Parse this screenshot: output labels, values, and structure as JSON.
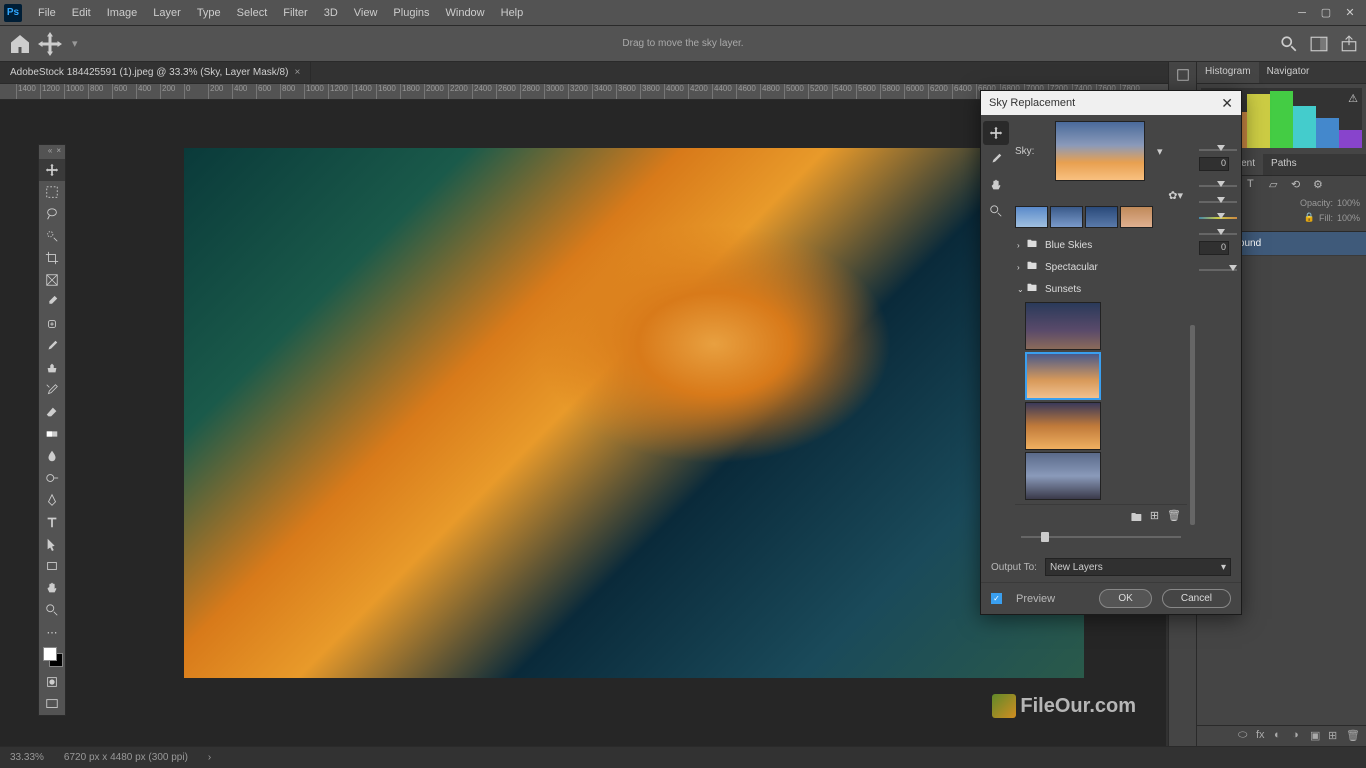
{
  "app": {
    "logo": "Ps"
  },
  "menubar": [
    "File",
    "Edit",
    "Image",
    "Layer",
    "Type",
    "Select",
    "Filter",
    "3D",
    "View",
    "Plugins",
    "Window",
    "Help"
  ],
  "optionsbar": {
    "hint": "Drag to move the sky layer."
  },
  "doctab": {
    "title": "AdobeStock 184425591 (1).jpeg @ 33.3% (Sky, Layer Mask/8)",
    "close": "×"
  },
  "ruler_marks": [
    "1400",
    "1200",
    "1000",
    "800",
    "600",
    "400",
    "200",
    "0",
    "200",
    "400",
    "600",
    "800",
    "1000",
    "1200",
    "1400",
    "1600",
    "1800",
    "2000",
    "2200",
    "2400",
    "2600",
    "2800",
    "3000",
    "3200",
    "3400",
    "3600",
    "3800",
    "4000",
    "4200",
    "4400",
    "4600",
    "4800",
    "5000",
    "5200",
    "5400",
    "5600",
    "5800",
    "6000",
    "6200",
    "6400",
    "6600",
    "6800",
    "7000",
    "7200",
    "7400",
    "7600",
    "7800"
  ],
  "dialog": {
    "title": "Sky Replacement",
    "sky_label": "Sky:",
    "categories": [
      {
        "name": "Blue Skies",
        "open": false
      },
      {
        "name": "Spectacular",
        "open": false
      },
      {
        "name": "Sunsets",
        "open": true
      }
    ],
    "output_label": "Output To:",
    "output_value": "New Layers",
    "preview_label": "Preview",
    "ok": "OK",
    "cancel": "Cancel",
    "slider_vals": [
      "0",
      "0"
    ]
  },
  "right_panel": {
    "tabs1": [
      "Histogram",
      "Navigator"
    ],
    "tabs2": [
      "Adjustment",
      "Paths"
    ],
    "opacity_label": "Opacity:",
    "opacity_val": "100%",
    "fill_label": "Fill:",
    "fill_val": "100%",
    "layer_bg": "kground"
  },
  "statusbar": {
    "zoom": "33.33%",
    "dims": "6720 px x 4480 px (300 ppi)"
  },
  "watermark": "FileOur.com"
}
